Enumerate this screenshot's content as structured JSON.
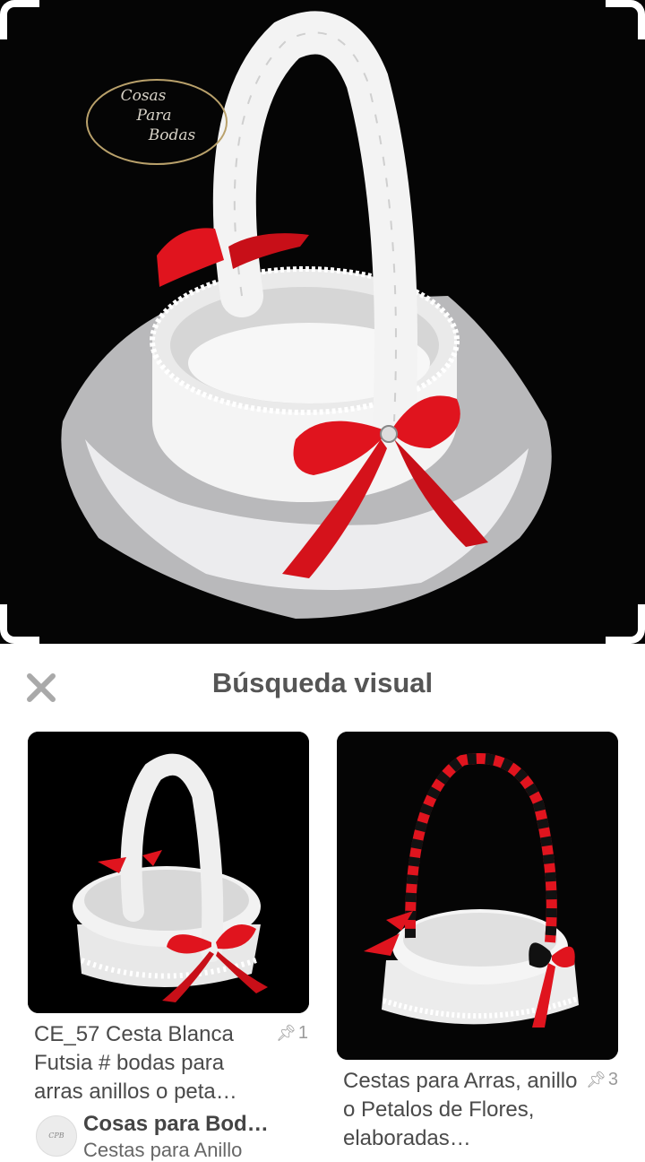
{
  "hero": {
    "logo_lines": [
      "Cosas",
      "Para",
      "Bodas"
    ]
  },
  "panel": {
    "title": "Búsqueda visual",
    "close_icon": "close-icon"
  },
  "results": [
    {
      "description": "CE_57 Cesta Blanca Futsia # bodas para arras anillos o peta…",
      "pin_icon": "pin-icon",
      "save_count": "1",
      "board_name": "Cosas para Bod…",
      "board_sub": "Cestas para Anillo"
    },
    {
      "description": "Cestas para Arras, anillo o Petalos de Flores, elaboradas…",
      "pin_icon": "pin-icon",
      "save_count": "3"
    }
  ],
  "colors": {
    "ribbon_red": "#e0141e",
    "photo_bg": "#050505",
    "title_gray": "#555555"
  }
}
